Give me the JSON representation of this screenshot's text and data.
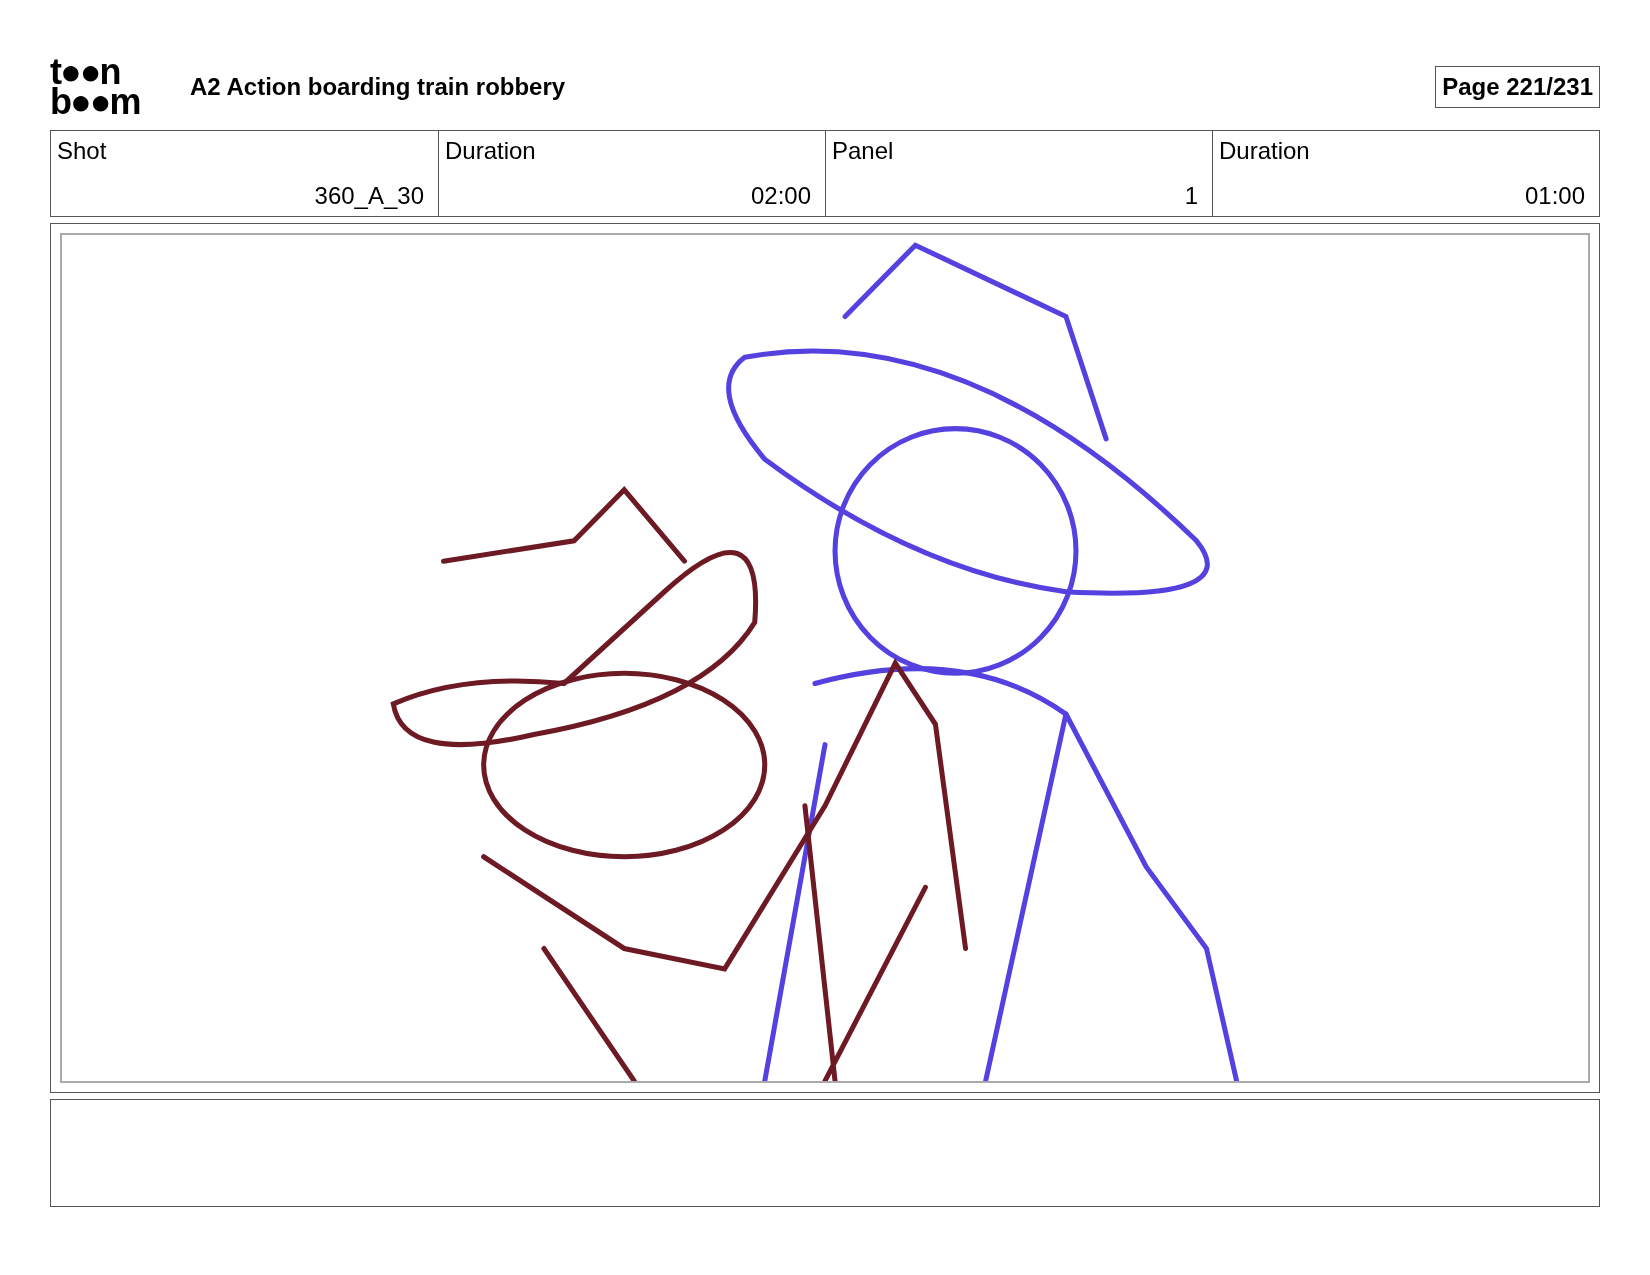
{
  "logo_rows": [
    "t●●n",
    "b●●m"
  ],
  "title": "A2 Action boarding train robbery",
  "page": "Page 221/231",
  "fields": [
    {
      "label": "Shot",
      "value": "360_A_30"
    },
    {
      "label": "Duration",
      "value": "02:00"
    },
    {
      "label": "Panel",
      "value": "1"
    },
    {
      "label": "Duration",
      "value": "01:00"
    }
  ]
}
